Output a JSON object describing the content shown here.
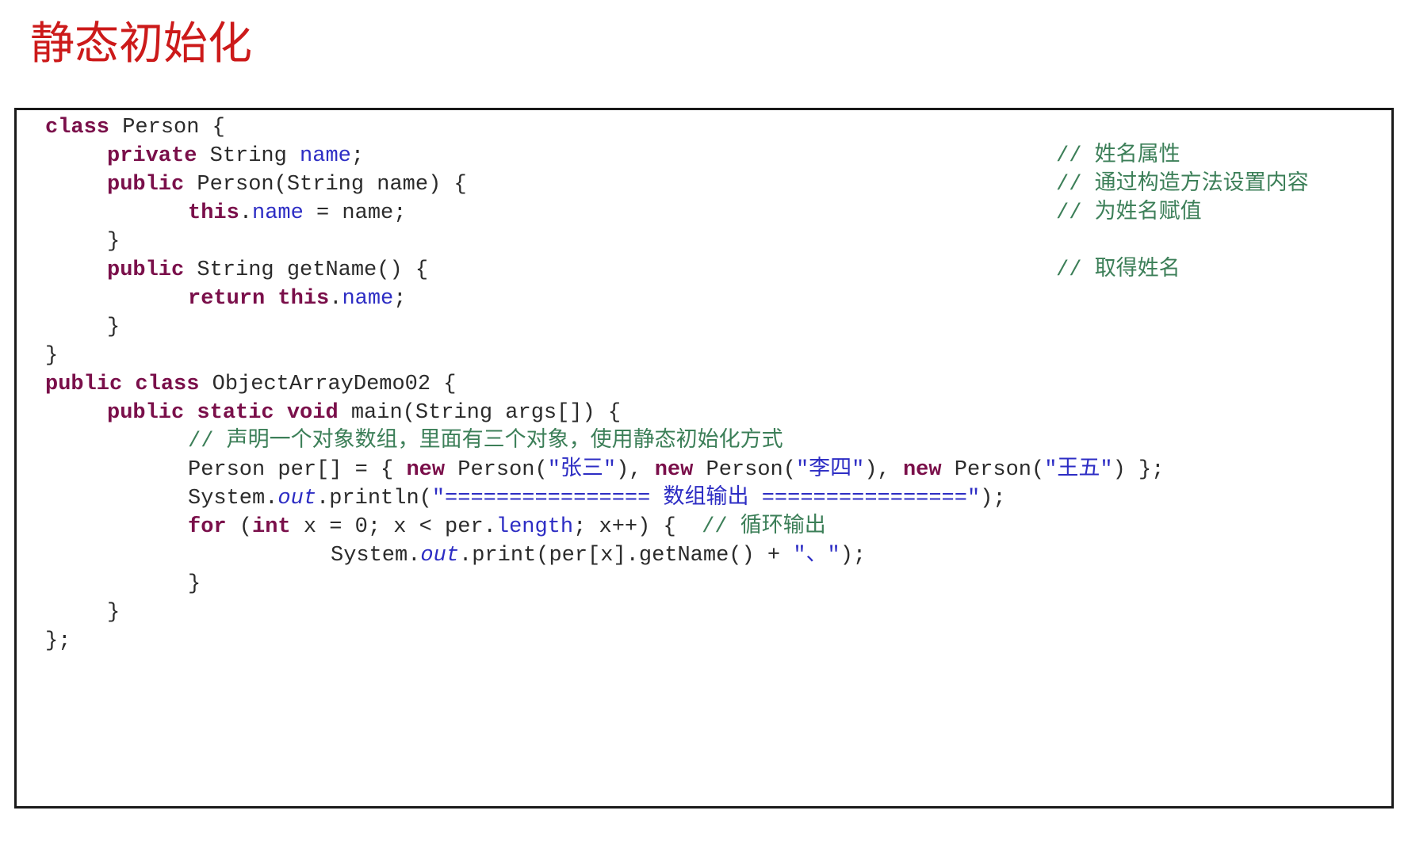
{
  "title": "静态初始化",
  "kw": {
    "class": "class",
    "private": "private",
    "public": "public",
    "this": "this",
    "return": "return",
    "static": "static",
    "void": "void",
    "new": "new",
    "for": "for",
    "int": "int"
  },
  "code": {
    "l1_text": " Person {",
    "l2_type": " String ",
    "l2_field": "name",
    "l2_tail": ";",
    "l3_text": " Person(String name) {",
    "l4_dot": ".",
    "l4_field": "name",
    "l4_tail": " = name;",
    "brace_close": "}",
    "l6_text": " String getName() {",
    "l7_sp": " ",
    "l7_dot": ".",
    "l7_field": "name",
    "l7_tail": ";",
    "l11_text": " ObjectArrayDemo02 {",
    "l12_text": " main(String args[]) {",
    "l13_comment": "// 声明一个对象数组，里面有三个对象，使用静态初始化方式",
    "l14_head": "Person per[] = { ",
    "l14_p1": " Person(",
    "l14_s1": "\"张三\"",
    "l14_sep1": "), ",
    "l14_p2": " Person(",
    "l14_s2": "\"李四\"",
    "l14_sep2": "), ",
    "l14_p3": " Person(",
    "l14_s3": "\"王五\"",
    "l14_tail": ") };",
    "l15_head": "System.",
    "out": "out",
    "l15_mid": ".println(",
    "l15_str": "\"================ 数组输出 ================\"",
    "l15_tail": ");",
    "l16_mid1": " (",
    "l16_mid2": " x = 0; x < per.",
    "l16_field": "length",
    "l16_tail": "; x++) {  ",
    "l16_comment": "// 循环输出",
    "l17_head": "System.",
    "l17_mid": ".print(per[x].getName() + ",
    "l17_str": "\"、\"",
    "l17_tail": ");",
    "l21_text": "};"
  },
  "comments": {
    "c2": "// 姓名属性",
    "c3": "// 通过构造方法设置内容",
    "c4": "// 为姓名赋值",
    "c6": "// 取得姓名"
  }
}
